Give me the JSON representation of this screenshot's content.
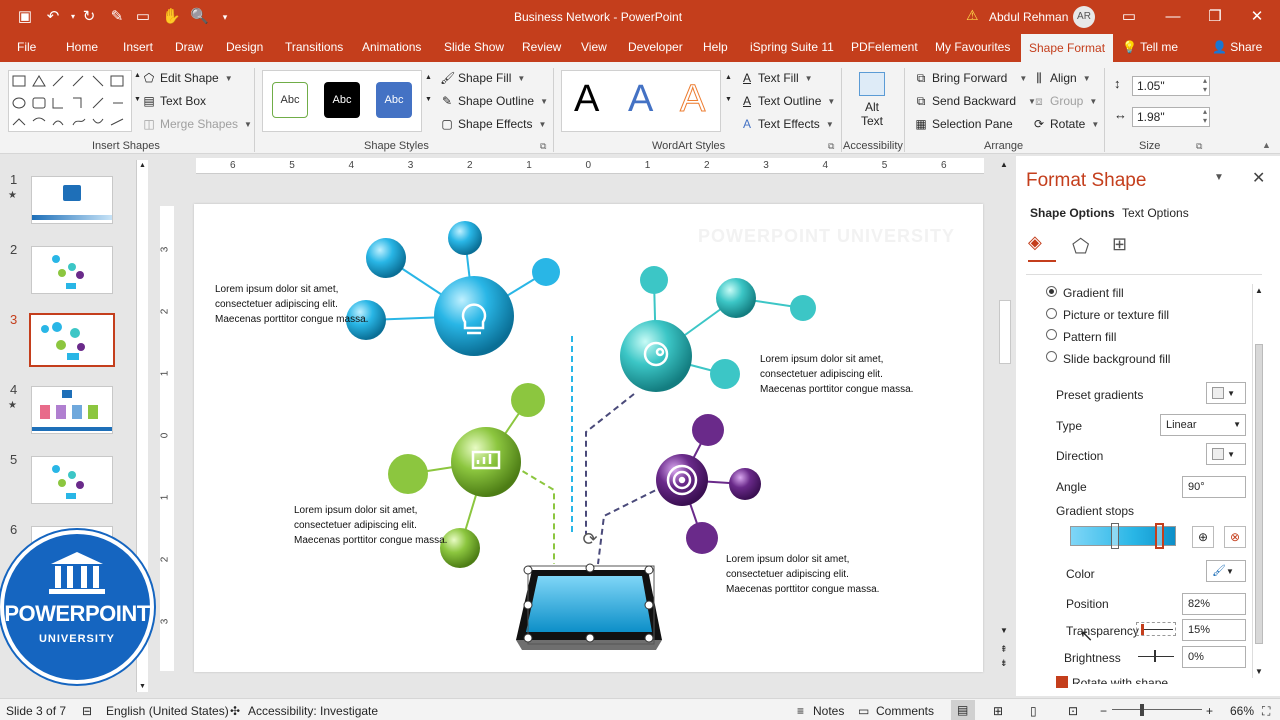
{
  "window": {
    "title": "Business Network  -  PowerPoint",
    "user_name": "Abdul Rehman",
    "user_initials": "AR",
    "warning_icon": "warning-icon"
  },
  "tabs": [
    "File",
    "Home",
    "Insert",
    "Draw",
    "Design",
    "Transitions",
    "Animations",
    "Slide Show",
    "Review",
    "View",
    "Developer",
    "Help",
    "iSpring Suite 11",
    "PDFelement",
    "My Favourites",
    "Shape Format",
    "Tell me",
    "Share"
  ],
  "active_tab": "Shape Format",
  "ribbon": {
    "insert_shapes": {
      "label": "Insert Shapes",
      "edit_shape": "Edit Shape",
      "text_box": "Text Box",
      "merge_shapes": "Merge Shapes"
    },
    "shape_styles": {
      "label": "Shape Styles",
      "presets": [
        "Abc",
        "Abc",
        "Abc"
      ],
      "shape_fill": "Shape Fill",
      "shape_outline": "Shape Outline",
      "shape_effects": "Shape Effects"
    },
    "wordart_styles": {
      "label": "WordArt Styles",
      "letters": [
        "A",
        "A",
        "A"
      ],
      "text_fill": "Text Fill",
      "text_outline": "Text Outline",
      "text_effects": "Text Effects"
    },
    "accessibility": {
      "label": "Accessibility",
      "alt_text_line1": "Alt",
      "alt_text_line2": "Text"
    },
    "arrange": {
      "label": "Arrange",
      "bring_forward": "Bring Forward",
      "send_backward": "Send Backward",
      "selection_pane": "Selection Pane",
      "align": "Align",
      "group": "Group",
      "rotate": "Rotate"
    },
    "size": {
      "label": "Size",
      "height": "1.05\"",
      "width": "1.98\""
    }
  },
  "thumbnails": [
    {
      "num": "1",
      "star": "★"
    },
    {
      "num": "2",
      "star": ""
    },
    {
      "num": "3",
      "star": ""
    },
    {
      "num": "4",
      "star": "★"
    },
    {
      "num": "5",
      "star": ""
    },
    {
      "num": "6",
      "star": ""
    }
  ],
  "ruler_h": [
    "6",
    "5",
    "4",
    "3",
    "2",
    "1",
    "0",
    "1",
    "2",
    "3",
    "4",
    "5",
    "6"
  ],
  "ruler_v": [
    "3",
    "2",
    "1",
    "0",
    "1",
    "2",
    "3"
  ],
  "slide": {
    "watermark": "POWERPOINT UNIVERSITY",
    "lorem1": "Lorem ipsum dolor sit amet, consectetuer adipiscing elit. Maecenas porttitor congue massa.",
    "lorem2": "Lorem ipsum dolor sit amet, consectetuer adipiscing elit. Maecenas porttitor congue massa.",
    "lorem3": "Lorem ipsum dolor sit amet, consectetuer adipiscing elit. Maecenas porttitor congue massa.",
    "lorem4": "Lorem ipsum dolor sit amet, consectetuer adipiscing elit. Maecenas porttitor congue massa."
  },
  "logo": {
    "line1": "POWERPOINT",
    "line2": "UNIVERSITY"
  },
  "pane": {
    "title": "Format Shape",
    "tab_shape": "Shape Options",
    "tab_text": "Text Options",
    "fill_options": [
      {
        "label": "Gradient fill",
        "selected": true
      },
      {
        "label": "Picture or texture fill",
        "selected": false
      },
      {
        "label": "Pattern fill",
        "selected": false
      },
      {
        "label": "Slide background fill",
        "selected": false
      }
    ],
    "preset_gradients": "Preset gradients",
    "type_label": "Type",
    "type_value": "Linear",
    "direction_label": "Direction",
    "angle_label": "Angle",
    "angle_value": "90°",
    "gradient_stops": "Gradient stops",
    "color_label": "Color",
    "position_label": "Position",
    "position_value": "82%",
    "transparency_label": "Transparency",
    "transparency_value": "15%",
    "brightness_label": "Brightness",
    "brightness_value": "0%",
    "rotate_with_shape": "Rotate with shape"
  },
  "status": {
    "slide_info": "Slide 3 of 7",
    "language": "English (United States)",
    "accessibility": "Accessibility: Investigate",
    "notes": "Notes",
    "comments": "Comments",
    "zoom": "66%"
  },
  "colors": {
    "brand": "#c43e1c",
    "cyan": "#29b6e6",
    "green": "#8cc63f",
    "purple": "#6a2a8a",
    "teal": "#3cc6c6"
  }
}
